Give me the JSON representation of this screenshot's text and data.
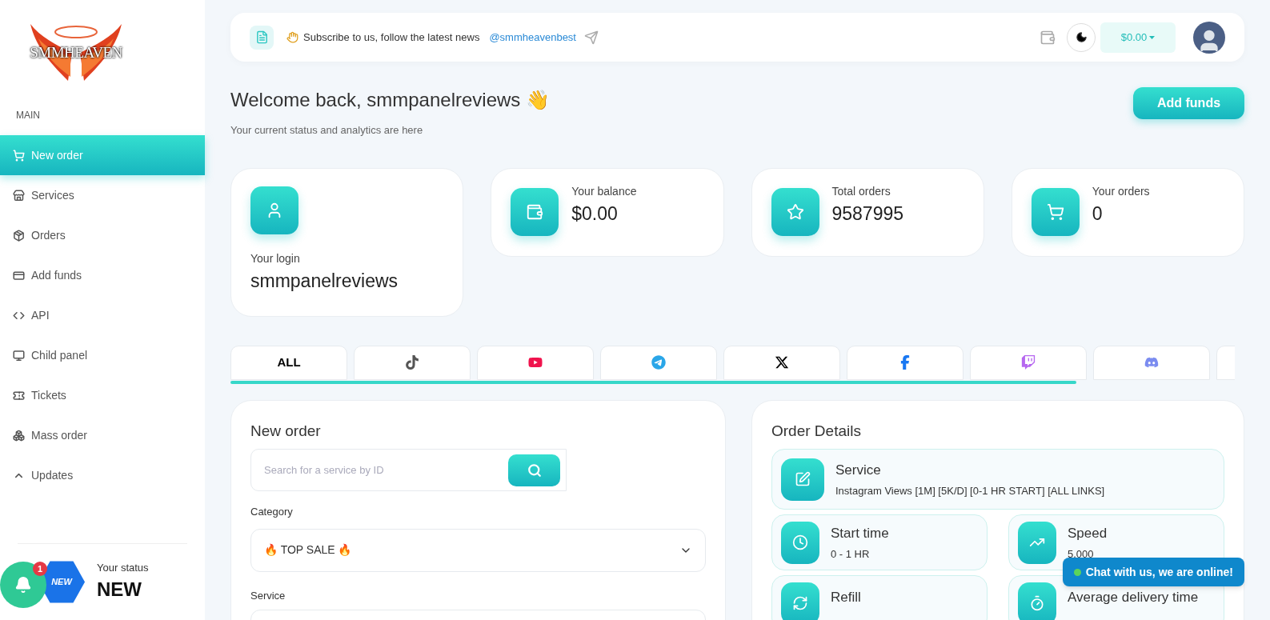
{
  "sidebar": {
    "logo_text": "SMMHEAVEN",
    "section": "MAIN",
    "items": [
      {
        "label": "New order",
        "selected": true
      },
      {
        "label": "Services",
        "selected": false
      },
      {
        "label": "Orders",
        "selected": false
      },
      {
        "label": "Add funds",
        "selected": false
      },
      {
        "label": "API",
        "selected": false
      },
      {
        "label": "Child panel",
        "selected": false
      },
      {
        "label": "Tickets",
        "selected": false
      },
      {
        "label": "Mass order",
        "selected": false
      },
      {
        "label": "Updates",
        "selected": false
      }
    ],
    "status": {
      "badge": "NEW",
      "label": "Your status",
      "value": "NEW"
    },
    "notifications": {
      "count": "1"
    }
  },
  "topbar": {
    "news": "Subscribe to us, follow the latest news",
    "link": "@smmheavenbest",
    "balance": "$0.00"
  },
  "welcome": {
    "title": "Welcome back, smmpanelreviews 👋",
    "subtitle": "Your current status and analytics are here",
    "button": "Add funds"
  },
  "stats": [
    {
      "label": "Your login",
      "value": "smmpanelreviews"
    },
    {
      "label": "Your balance",
      "value": "$0.00"
    },
    {
      "label": "Total orders",
      "value": "9587995"
    },
    {
      "label": "Your orders",
      "value": "0"
    }
  ],
  "platforms": [
    {
      "kind": "all",
      "label": "ALL"
    },
    {
      "kind": "tiktok"
    },
    {
      "kind": "youtube"
    },
    {
      "kind": "telegram"
    },
    {
      "kind": "x"
    },
    {
      "kind": "facebook"
    },
    {
      "kind": "twitch"
    },
    {
      "kind": "discord"
    },
    {
      "kind": "more"
    }
  ],
  "new_order": {
    "title": "New order",
    "search_placeholder": "Search for a service by ID",
    "category_label": "Category",
    "category_value": "🔥 TOP SALE 🔥",
    "service_label": "Service"
  },
  "order_details": {
    "title": "Order Details",
    "items": [
      {
        "label": "Service",
        "value": "Instagram Views [1M] [5K/D] [0-1 HR START] [ALL LINKS]"
      },
      {
        "label": "Start time",
        "value": "0 - 1 HR"
      },
      {
        "label": "Speed",
        "value": "5.000"
      },
      {
        "label": "Refill"
      },
      {
        "label": "Average delivery time"
      }
    ]
  },
  "chat": {
    "label": "Chat with us, we are online!"
  }
}
